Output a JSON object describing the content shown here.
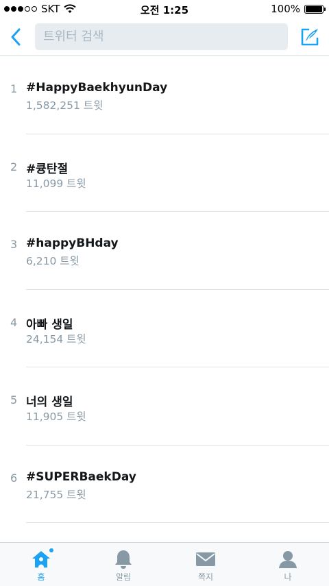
{
  "status_bar": {
    "carrier": "SKT",
    "time": "오전 1:25",
    "battery_percent": "100%",
    "signal_strength": 3,
    "signal_max": 5
  },
  "search": {
    "placeholder": "트위터 검색",
    "value": ""
  },
  "icons": {
    "back": "chevron-left-icon",
    "compose": "compose-tweet-icon",
    "home": "home-icon",
    "notifications": "bell-icon",
    "messages": "envelope-icon",
    "me": "person-icon"
  },
  "colors": {
    "accent": "#1da1f2",
    "secondary_text": "#8899a6",
    "tab_icon": "#8899a6",
    "search_bg": "#e6ecf0"
  },
  "trends": [
    {
      "rank": "1",
      "name": "#HappyBaekhyunDay",
      "count": "1,582,251 트윗"
    },
    {
      "rank": "2",
      "name": "#큥탄절",
      "count": "11,099 트윗"
    },
    {
      "rank": "3",
      "name": "#happyBHday",
      "count": "6,210 트윗"
    },
    {
      "rank": "4",
      "name": "아빠 생일",
      "count": "24,154 트윗"
    },
    {
      "rank": "5",
      "name": "너의 생일",
      "count": "11,905 트윗"
    },
    {
      "rank": "6",
      "name": "#SUPERBaekDay",
      "count": "21,755 트윗"
    }
  ],
  "tabs": [
    {
      "label": "홈",
      "active": true
    },
    {
      "label": "알림",
      "active": false
    },
    {
      "label": "쪽지",
      "active": false
    },
    {
      "label": "나",
      "active": false
    }
  ]
}
